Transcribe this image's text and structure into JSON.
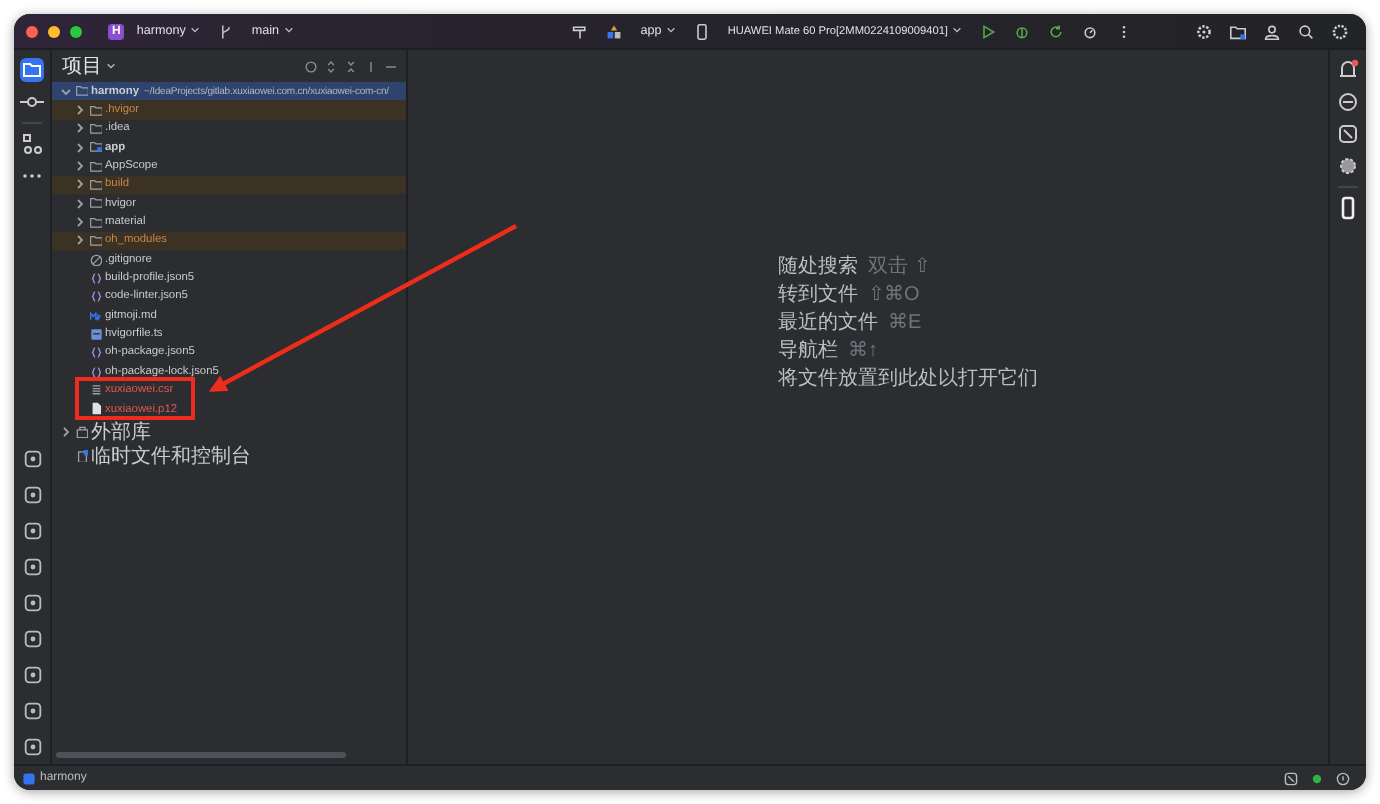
{
  "title_bar": {
    "project_initial": "H",
    "project": "harmony",
    "branch": "main",
    "run_config": "app",
    "device": "HUAWEI Mate 60 Pro[2MM0224109009401]"
  },
  "project_panel": {
    "title": "项目",
    "tree": [
      {
        "name": "harmony",
        "path": "~/IdeaProjects/gitlab.xuxiaowei.com.cn/xuxiaowei-com-cn/",
        "kind": "root",
        "expanded": true,
        "selected": true,
        "excluded": false,
        "untracked": false,
        "children": [
          {
            "name": ".hvigor",
            "kind": "folder",
            "expanded": false,
            "selected": false,
            "excluded": true,
            "untracked": false
          },
          {
            "name": ".idea",
            "kind": "folder",
            "expanded": false,
            "selected": false,
            "excluded": false,
            "untracked": false
          },
          {
            "name": "app",
            "kind": "module",
            "expanded": false,
            "selected": false,
            "excluded": false,
            "untracked": false
          },
          {
            "name": "AppScope",
            "kind": "folder",
            "expanded": false,
            "selected": false,
            "excluded": false,
            "untracked": false
          },
          {
            "name": "build",
            "kind": "folder",
            "expanded": false,
            "selected": false,
            "excluded": true,
            "untracked": false
          },
          {
            "name": "hvigor",
            "kind": "folder",
            "expanded": false,
            "selected": false,
            "excluded": false,
            "untracked": false
          },
          {
            "name": "material",
            "kind": "folder",
            "expanded": false,
            "selected": false,
            "excluded": false,
            "untracked": false
          },
          {
            "name": "oh_modules",
            "kind": "folder",
            "expanded": false,
            "selected": false,
            "excluded": true,
            "untracked": false
          },
          {
            "name": ".gitignore",
            "kind": "ignore",
            "selected": false,
            "excluded": false,
            "untracked": false
          },
          {
            "name": "build-profile.json5",
            "kind": "json",
            "selected": false,
            "excluded": false,
            "untracked": false
          },
          {
            "name": "code-linter.json5",
            "kind": "json",
            "selected": false,
            "excluded": false,
            "untracked": false
          },
          {
            "name": "gitmoji.md",
            "kind": "markdown",
            "selected": false,
            "excluded": false,
            "untracked": false
          },
          {
            "name": "hvigorfile.ts",
            "kind": "script",
            "selected": false,
            "excluded": false,
            "untracked": false
          },
          {
            "name": "oh-package.json5",
            "kind": "json",
            "selected": false,
            "excluded": false,
            "untracked": false
          },
          {
            "name": "oh-package-lock.json5",
            "kind": "json",
            "selected": false,
            "excluded": false,
            "untracked": false
          },
          {
            "name": "xuxiaowei.csr",
            "kind": "text",
            "selected": false,
            "excluded": false,
            "untracked": true
          },
          {
            "name": "xuxiaowei.p12",
            "kind": "document",
            "selected": false,
            "excluded": false,
            "untracked": true
          }
        ]
      },
      {
        "name": "外部库",
        "kind": "library",
        "expanded": false,
        "selected": false,
        "excluded": false,
        "untracked": false
      },
      {
        "name": "临时文件和控制台",
        "kind": "scratch",
        "selected": false,
        "excluded": false,
        "untracked": false
      }
    ]
  },
  "editor_hints": [
    {
      "label": "随处搜索",
      "shortcut": "双击 ⇧"
    },
    {
      "label": "转到文件",
      "shortcut": "⇧⌘O"
    },
    {
      "label": "最近的文件",
      "shortcut": "⌘E"
    },
    {
      "label": "导航栏",
      "shortcut": "⌘↑"
    },
    {
      "label": "将文件放置到此处以打开它们"
    }
  ],
  "status_bar": {
    "project": "harmony"
  }
}
